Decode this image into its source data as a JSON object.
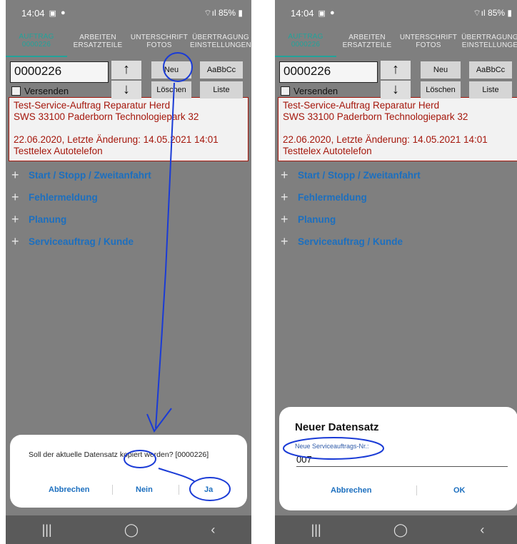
{
  "status": {
    "time": "14:04",
    "battery": "85%"
  },
  "tabs": [
    {
      "line1": "AUFTRAG",
      "line2": "0000226"
    },
    {
      "line1": "ARBEITEN",
      "line2": "ERSATZTEILE"
    },
    {
      "line1": "UNTERSCHRIFT",
      "line2": "FOTOS"
    },
    {
      "line1": "ÜBERTRAGUNG",
      "line2": "EINSTELLUNGEN"
    }
  ],
  "right_tabs_last": {
    "line1": "ÜBERTRAGUNG",
    "line2": "EINSTELLUNGE"
  },
  "order_input": "0000226",
  "versenden": "Versenden",
  "buttons": {
    "neu": "Neu",
    "font": "AaBbCc",
    "loeschen": "Löschen",
    "liste": "Liste",
    "up": "↑",
    "down": "↓"
  },
  "info": {
    "line1": "Test-Service-Auftrag Reparatur Herd",
    "line2": "SWS 33100 Paderborn Technologiepark 32",
    "line3": "22.06.2020, Letzte Änderung: 14.05.2021 14:01",
    "line4": "Testtelex Autotelefon"
  },
  "sections": [
    "Start / Stopp / Zweitanfahrt",
    "Fehlermeldung",
    "Planung",
    "Serviceauftrag / Kunde"
  ],
  "plus_glyph": "+",
  "dialog_left": {
    "message": "Soll der aktuelle Datensatz kopiert werden? [0000226]",
    "cancel": "Abbrechen",
    "no": "Nein",
    "yes": "Ja"
  },
  "dialog_right": {
    "title": "Neuer Datensatz",
    "label": "Neue Serviceauftrags-Nr.:",
    "value": "007",
    "cancel": "Abbrechen",
    "ok": "OK"
  },
  "navbar": {
    "recent": "|||",
    "home": "◯",
    "back": "‹"
  },
  "colors": {
    "accent": "#22a39a",
    "link": "#1c6fbf",
    "info_text": "#a5170c",
    "annotation": "#1a3bd6"
  }
}
